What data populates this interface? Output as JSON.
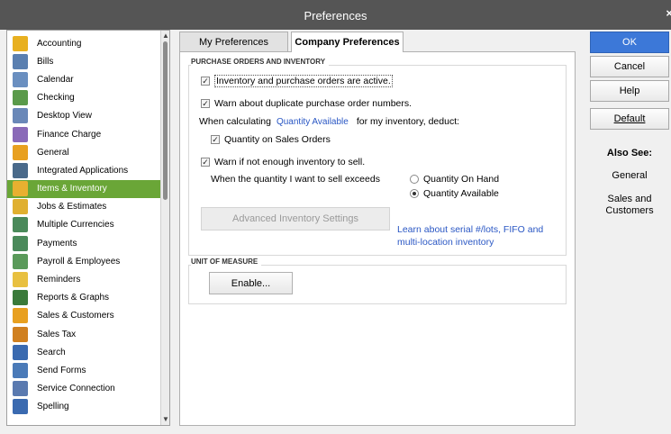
{
  "window": {
    "title": "Preferences",
    "close_label": "×"
  },
  "categories": [
    {
      "label": "Accounting",
      "color": "#e8b020"
    },
    {
      "label": "Bills",
      "color": "#5a7fb0"
    },
    {
      "label": "Calendar",
      "color": "#6a8fc0"
    },
    {
      "label": "Checking",
      "color": "#5a9a4a"
    },
    {
      "label": "Desktop View",
      "color": "#6a88b8"
    },
    {
      "label": "Finance Charge",
      "color": "#8a6ab8"
    },
    {
      "label": "General",
      "color": "#e8a020"
    },
    {
      "label": "Integrated Applications",
      "color": "#4a6a8a"
    },
    {
      "label": "Items & Inventory",
      "color": "#e8b030"
    },
    {
      "label": "Jobs & Estimates",
      "color": "#e0b030"
    },
    {
      "label": "Multiple Currencies",
      "color": "#4a8a5a"
    },
    {
      "label": "Payments",
      "color": "#4a8a5a"
    },
    {
      "label": "Payroll & Employees",
      "color": "#5a9a5a"
    },
    {
      "label": "Reminders",
      "color": "#e8c040"
    },
    {
      "label": "Reports & Graphs",
      "color": "#3a7a3a"
    },
    {
      "label": "Sales & Customers",
      "color": "#e8a020"
    },
    {
      "label": "Sales Tax",
      "color": "#d08020"
    },
    {
      "label": "Search",
      "color": "#3a6ab0"
    },
    {
      "label": "Send Forms",
      "color": "#4a7ab8"
    },
    {
      "label": "Service Connection",
      "color": "#5a7ab0"
    },
    {
      "label": "Spelling",
      "color": "#3a6ab0"
    }
  ],
  "selected_category": "Items & Inventory",
  "tabs": {
    "my": "My Preferences",
    "company": "Company Preferences"
  },
  "po_section": {
    "title": "PURCHASE ORDERS AND INVENTORY",
    "inventory_active": "Inventory and purchase orders are active.",
    "warn_duplicate": "Warn about duplicate purchase order numbers.",
    "calc_prefix": "When calculating",
    "calc_link": "Quantity Available",
    "calc_suffix": "for my inventory, deduct:",
    "qty_sales_orders": "Quantity on Sales Orders",
    "warn_not_enough": "Warn if not enough inventory to sell.",
    "exceeds_label": "When the quantity I want to sell exceeds",
    "radio_on_hand": "Quantity On Hand",
    "radio_available": "Quantity Available",
    "advanced_button": "Advanced Inventory Settings",
    "learn_link_1": "Learn about serial #/lots, FIFO and",
    "learn_link_2": "multi-location inventory"
  },
  "uom_section": {
    "title": "UNIT OF MEASURE",
    "enable_button": "Enable..."
  },
  "actions": {
    "ok": "OK",
    "cancel": "Cancel",
    "help": "Help",
    "default": "Default"
  },
  "also_see": {
    "title": "Also See:",
    "general": "General",
    "sales_1": "Sales and",
    "sales_2": "Customers"
  },
  "colors": {
    "accent": "#6aa637",
    "ok_button": "#3c78d8",
    "link": "#2a57c4",
    "titlebar": "#555555"
  }
}
